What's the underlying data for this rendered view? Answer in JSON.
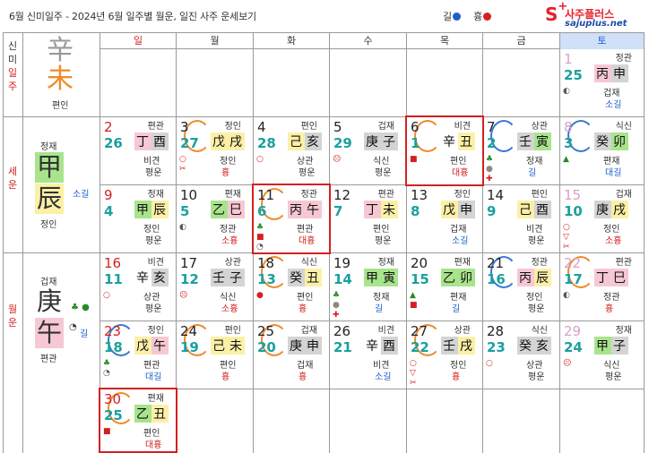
{
  "header": {
    "title": "6월 신미일주 - 2024년 6월 일주별 월운, 일진 사주 운세보기",
    "legend_good_label": "길",
    "legend_bad_label": "흉",
    "legend_good_color": "#1c5fcc",
    "legend_bad_color": "#d42020"
  },
  "logo": {
    "mark": "S",
    "plus": "+",
    "name": "사주플러스",
    "url": "sajuplus.net"
  },
  "side_labels": {
    "ilju": [
      "신",
      "미",
      "일",
      "주"
    ],
    "seun": [
      "세",
      "운"
    ],
    "wolun": [
      "월",
      "운"
    ]
  },
  "weekdays": [
    "일",
    "월",
    "화",
    "수",
    "목",
    "금",
    "토"
  ],
  "ilju_block": {
    "stem": "辛",
    "branch": "未",
    "branch_god": "편인",
    "stem_color": "#999999",
    "branch_color": "#ef8a2a"
  },
  "seun_block": {
    "stem_god": "정재",
    "stem": "甲",
    "branch": "辰",
    "branch_god": "정인",
    "fortune": "소길"
  },
  "wolun_block": {
    "stem_god": "겁재",
    "stem": "庚",
    "branch": "午",
    "branch_god": "편관",
    "fortune": "길"
  },
  "days": [
    {
      "solar": "1",
      "lunar": "25",
      "stem_god": "정관",
      "pillar": [
        "丙",
        "申"
      ],
      "bg": [
        "bg-pink",
        "bg-gray"
      ],
      "branch_god": "겁재",
      "fortune": "소길",
      "ftype": "good",
      "marks": [
        "◐"
      ],
      "col": 6,
      "row": 0
    },
    {
      "solar": "2",
      "lunar": "26",
      "stem_god": "편관",
      "pillar": [
        "丁",
        "酉"
      ],
      "bg": [
        "bg-pink",
        "bg-gray"
      ],
      "branch_god": "비견",
      "fortune": "평운",
      "ftype": "neu",
      "marks": [],
      "col": 0,
      "row": 1
    },
    {
      "solar": "3",
      "lunar": "27",
      "stem_god": "정인",
      "pillar": [
        "戊",
        "戌"
      ],
      "bg": [
        "bg-yellow",
        "bg-yellow"
      ],
      "branch_god": "정인",
      "fortune": "흉",
      "ftype": "bad",
      "marks": [
        "○",
        "✂"
      ],
      "col": 1,
      "row": 1,
      "arc": "orange"
    },
    {
      "solar": "4",
      "lunar": "28",
      "stem_god": "편인",
      "pillar": [
        "己",
        "亥"
      ],
      "bg": [
        "bg-yellow",
        "bg-gray"
      ],
      "branch_god": "상관",
      "fortune": "평운",
      "ftype": "neu",
      "marks": [
        "○"
      ],
      "col": 2,
      "row": 1
    },
    {
      "solar": "5",
      "lunar": "29",
      "stem_god": "겁재",
      "pillar": [
        "庚",
        "子"
      ],
      "bg": [
        "bg-gray",
        "bg-gray"
      ],
      "branch_god": "식신",
      "fortune": "평운",
      "ftype": "neu",
      "marks": [
        "☹"
      ],
      "col": 3,
      "row": 1
    },
    {
      "solar": "6",
      "lunar": "1",
      "stem_god": "비견",
      "pillar": [
        "辛",
        "丑"
      ],
      "bg": [
        "",
        "bg-yellow"
      ],
      "branch_god": "편인",
      "fortune": "대흉",
      "ftype": "bad",
      "marks": [
        "■"
      ],
      "col": 4,
      "row": 1,
      "arc": "orange",
      "highlight": true
    },
    {
      "solar": "7",
      "lunar": "2",
      "stem_god": "상관",
      "pillar": [
        "壬",
        "寅"
      ],
      "bg": [
        "bg-gray",
        "bg-green"
      ],
      "branch_god": "정재",
      "fortune": "길",
      "ftype": "good",
      "marks": [
        "♣",
        "●",
        "✚"
      ],
      "col": 5,
      "row": 1,
      "arc": "blue"
    },
    {
      "solar": "8",
      "lunar": "3",
      "stem_god": "식신",
      "pillar": [
        "癸",
        "卯"
      ],
      "bg": [
        "bg-gray",
        "bg-green"
      ],
      "branch_god": "편재",
      "fortune": "대길",
      "ftype": "good",
      "marks": [
        "▲"
      ],
      "col": 6,
      "row": 1,
      "arc": "blue"
    },
    {
      "solar": "9",
      "lunar": "4",
      "stem_god": "정재",
      "pillar": [
        "甲",
        "辰"
      ],
      "bg": [
        "bg-green",
        "bg-yellow"
      ],
      "branch_god": "정인",
      "fortune": "평운",
      "ftype": "neu",
      "marks": [],
      "col": 0,
      "row": 2
    },
    {
      "solar": "10",
      "lunar": "5",
      "stem_god": "편재",
      "pillar": [
        "乙",
        "巳"
      ],
      "bg": [
        "bg-green",
        "bg-pink"
      ],
      "branch_god": "정관",
      "fortune": "소흉",
      "ftype": "bad",
      "marks": [
        "◐"
      ],
      "col": 1,
      "row": 2
    },
    {
      "solar": "11",
      "lunar": "6",
      "stem_god": "정관",
      "pillar": [
        "丙",
        "午"
      ],
      "bg": [
        "bg-pink",
        "bg-pink"
      ],
      "branch_god": "편관",
      "fortune": "대흉",
      "ftype": "bad",
      "marks": [
        "♣",
        "■",
        "◔"
      ],
      "col": 2,
      "row": 2,
      "arc": "orange",
      "highlight": true
    },
    {
      "solar": "12",
      "lunar": "7",
      "stem_god": "편관",
      "pillar": [
        "丁",
        "未"
      ],
      "bg": [
        "bg-pink",
        "bg-yellow"
      ],
      "branch_god": "편인",
      "fortune": "평운",
      "ftype": "neu",
      "marks": [],
      "col": 3,
      "row": 2
    },
    {
      "solar": "13",
      "lunar": "8",
      "stem_god": "정인",
      "pillar": [
        "戊",
        "申"
      ],
      "bg": [
        "bg-yellow",
        "bg-gray"
      ],
      "branch_god": "겁재",
      "fortune": "소길",
      "ftype": "good",
      "marks": [],
      "col": 4,
      "row": 2
    },
    {
      "solar": "14",
      "lunar": "9",
      "stem_god": "편인",
      "pillar": [
        "己",
        "酉"
      ],
      "bg": [
        "bg-yellow",
        "bg-gray"
      ],
      "branch_god": "비견",
      "fortune": "평운",
      "ftype": "neu",
      "marks": [],
      "col": 5,
      "row": 2
    },
    {
      "solar": "15",
      "lunar": "10",
      "stem_god": "겁재",
      "pillar": [
        "庚",
        "戌"
      ],
      "bg": [
        "bg-gray",
        "bg-yellow"
      ],
      "branch_god": "정인",
      "fortune": "소흉",
      "ftype": "bad",
      "marks": [
        "○",
        "▽",
        "✂"
      ],
      "col": 6,
      "row": 2
    },
    {
      "solar": "16",
      "lunar": "11",
      "stem_god": "비견",
      "pillar": [
        "辛",
        "亥"
      ],
      "bg": [
        "",
        "bg-gray"
      ],
      "branch_god": "상관",
      "fortune": "평운",
      "ftype": "neu",
      "marks": [
        "○"
      ],
      "col": 0,
      "row": 3
    },
    {
      "solar": "17",
      "lunar": "12",
      "stem_god": "상관",
      "pillar": [
        "壬",
        "子"
      ],
      "bg": [
        "bg-gray",
        "bg-gray"
      ],
      "branch_god": "식신",
      "fortune": "소흉",
      "ftype": "bad",
      "marks": [
        "☹"
      ],
      "col": 1,
      "row": 3
    },
    {
      "solar": "18",
      "lunar": "13",
      "stem_god": "식신",
      "pillar": [
        "癸",
        "丑"
      ],
      "bg": [
        "bg-gray",
        "bg-yellow"
      ],
      "branch_god": "편인",
      "fortune": "흉",
      "ftype": "bad",
      "marks": [
        "●"
      ],
      "col": 2,
      "row": 3,
      "arc": "orange"
    },
    {
      "solar": "19",
      "lunar": "14",
      "stem_god": "정재",
      "pillar": [
        "甲",
        "寅"
      ],
      "bg": [
        "bg-green",
        "bg-green"
      ],
      "branch_god": "정재",
      "fortune": "길",
      "ftype": "good",
      "marks": [
        "♣",
        "●",
        "✚"
      ],
      "col": 3,
      "row": 3
    },
    {
      "solar": "20",
      "lunar": "15",
      "stem_god": "편재",
      "pillar": [
        "乙",
        "卯"
      ],
      "bg": [
        "bg-green",
        "bg-green"
      ],
      "branch_god": "편재",
      "fortune": "길",
      "ftype": "good",
      "marks": [
        "▲",
        "■"
      ],
      "col": 4,
      "row": 3
    },
    {
      "solar": "21",
      "lunar": "16",
      "stem_god": "정관",
      "pillar": [
        "丙",
        "辰"
      ],
      "bg": [
        "bg-pink",
        "bg-yellow"
      ],
      "branch_god": "정인",
      "fortune": "평운",
      "ftype": "neu",
      "marks": [],
      "col": 5,
      "row": 3,
      "arc": "blue"
    },
    {
      "solar": "22",
      "lunar": "17",
      "stem_god": "편관",
      "pillar": [
        "丁",
        "巳"
      ],
      "bg": [
        "bg-pink",
        "bg-pink"
      ],
      "branch_god": "정관",
      "fortune": "흉",
      "ftype": "bad",
      "marks": [
        "◐"
      ],
      "col": 6,
      "row": 3,
      "arc": "orange"
    },
    {
      "solar": "23",
      "lunar": "18",
      "stem_god": "정인",
      "pillar": [
        "戊",
        "午"
      ],
      "bg": [
        "bg-yellow",
        "bg-pink"
      ],
      "branch_god": "편관",
      "fortune": "대길",
      "ftype": "good",
      "marks": [
        "♣",
        "◔"
      ],
      "col": 0,
      "row": 4,
      "arc": "blue"
    },
    {
      "solar": "24",
      "lunar": "19",
      "stem_god": "편인",
      "pillar": [
        "己",
        "未"
      ],
      "bg": [
        "bg-yellow",
        "bg-yellow"
      ],
      "branch_god": "편인",
      "fortune": "흉",
      "ftype": "bad",
      "marks": [],
      "col": 1,
      "row": 4,
      "arc": "orange"
    },
    {
      "solar": "25",
      "lunar": "20",
      "stem_god": "겁재",
      "pillar": [
        "庚",
        "申"
      ],
      "bg": [
        "bg-gray",
        "bg-gray"
      ],
      "branch_god": "겁재",
      "fortune": "흉",
      "ftype": "bad",
      "marks": [],
      "col": 2,
      "row": 4,
      "arc": "orange"
    },
    {
      "solar": "26",
      "lunar": "21",
      "stem_god": "비견",
      "pillar": [
        "辛",
        "酉"
      ],
      "bg": [
        "",
        "bg-gray"
      ],
      "branch_god": "비견",
      "fortune": "소길",
      "ftype": "good",
      "marks": [],
      "col": 3,
      "row": 4
    },
    {
      "solar": "27",
      "lunar": "22",
      "stem_god": "상관",
      "pillar": [
        "壬",
        "戌"
      ],
      "bg": [
        "bg-gray",
        "bg-yellow"
      ],
      "branch_god": "정인",
      "fortune": "흉",
      "ftype": "bad",
      "marks": [
        "○",
        "▽",
        "✂"
      ],
      "col": 4,
      "row": 4,
      "arc": "orange"
    },
    {
      "solar": "28",
      "lunar": "23",
      "stem_god": "식신",
      "pillar": [
        "癸",
        "亥"
      ],
      "bg": [
        "bg-gray",
        "bg-gray"
      ],
      "branch_god": "상관",
      "fortune": "평운",
      "ftype": "neu",
      "marks": [
        "○"
      ],
      "col": 5,
      "row": 4
    },
    {
      "solar": "29",
      "lunar": "24",
      "stem_god": "정재",
      "pillar": [
        "甲",
        "子"
      ],
      "bg": [
        "bg-green",
        "bg-gray"
      ],
      "branch_god": "식신",
      "fortune": "평운",
      "ftype": "neu",
      "marks": [
        "☹"
      ],
      "col": 6,
      "row": 4
    },
    {
      "solar": "30",
      "lunar": "25",
      "stem_god": "편재",
      "pillar": [
        "乙",
        "丑"
      ],
      "bg": [
        "bg-green",
        "bg-yellow"
      ],
      "branch_god": "편인",
      "fortune": "대흉",
      "ftype": "bad",
      "marks": [
        "■"
      ],
      "col": 0,
      "row": 5,
      "arc": "orange",
      "highlight": true
    }
  ]
}
